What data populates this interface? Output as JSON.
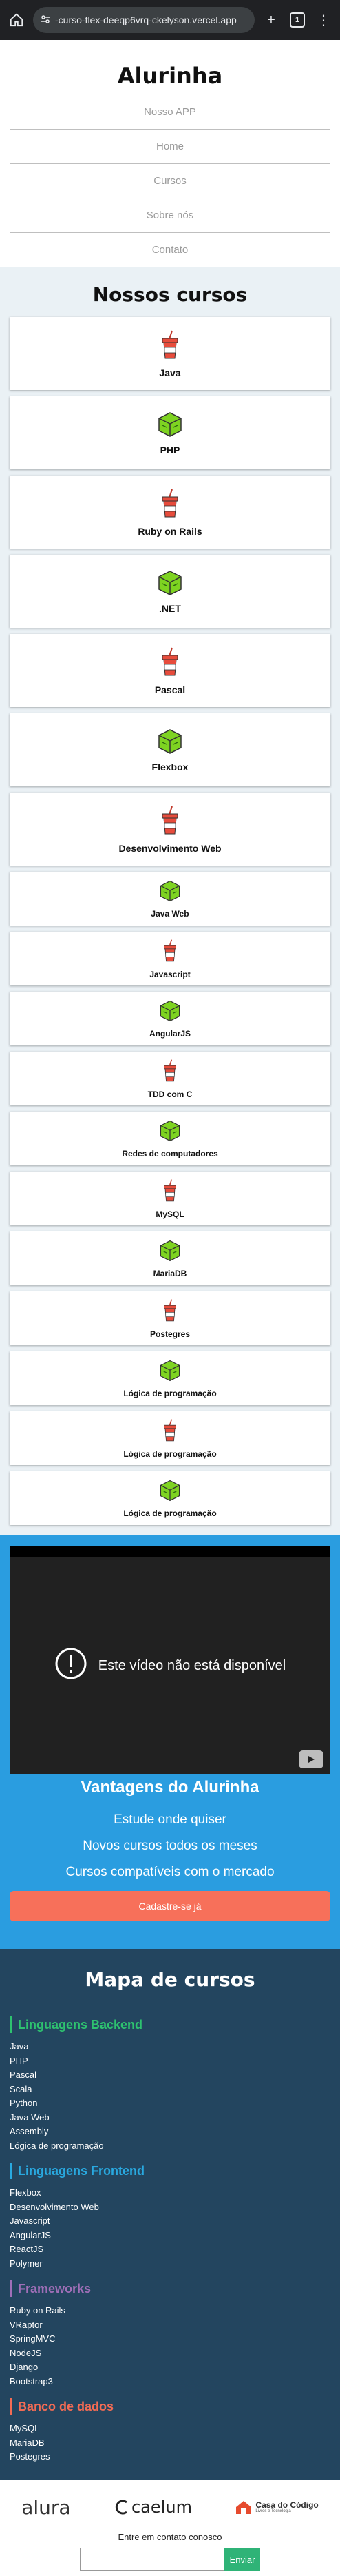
{
  "browser": {
    "url": "-curso-flex-deeqp6vrq-ckelyson.vercel.app",
    "tab_count": "1"
  },
  "header": {
    "brand": "Alurinha",
    "nav": [
      "Nosso APP",
      "Home",
      "Cursos",
      "Sobre nós",
      "Contato"
    ]
  },
  "courses": {
    "title": "Nossos cursos",
    "items": [
      {
        "name": "Java",
        "icon": "cup-icon"
      },
      {
        "name": "PHP",
        "icon": "box-icon"
      },
      {
        "name": "Ruby on Rails",
        "icon": "cup-icon"
      },
      {
        "name": ".NET",
        "icon": "box-icon"
      },
      {
        "name": "Pascal",
        "icon": "cup-icon"
      },
      {
        "name": "Flexbox",
        "icon": "box-icon"
      },
      {
        "name": "Desenvolvimento Web",
        "icon": "cup-icon"
      },
      {
        "name": "Java Web",
        "icon": "box-icon"
      },
      {
        "name": "Javascript",
        "icon": "cup-icon"
      },
      {
        "name": "AngularJS",
        "icon": "box-icon"
      },
      {
        "name": "TDD com C",
        "icon": "cup-icon"
      },
      {
        "name": "Redes de computadores",
        "icon": "box-icon"
      },
      {
        "name": "MySQL",
        "icon": "cup-icon"
      },
      {
        "name": "MariaDB",
        "icon": "box-icon"
      },
      {
        "name": "Postegres",
        "icon": "cup-icon"
      },
      {
        "name": "Lógica de programação",
        "icon": "box-icon"
      },
      {
        "name": "Lógica de programação",
        "icon": "cup-icon"
      },
      {
        "name": "Lógica de programação",
        "icon": "box-icon"
      }
    ]
  },
  "video": {
    "message": "Este vídeo não está disponível"
  },
  "advantages": {
    "title": "Vantagens do Alurinha",
    "items": [
      "Estude onde quiser",
      "Novos cursos todos os meses",
      "Cursos compatíveis com o mercado"
    ],
    "cta": "Cadastre-se já"
  },
  "map": {
    "title": "Mapa de cursos",
    "groups": [
      {
        "title": "Linguagens Backend",
        "color": "#2ec26f",
        "items": [
          "Java",
          "PHP",
          "Pascal",
          "Scala",
          "Python",
          "Java Web",
          "Assembly",
          "Lógica de programação"
        ]
      },
      {
        "title": "Linguagens Frontend",
        "color": "#29a9e0",
        "items": [
          "Flexbox",
          "Desenvolvimento Web",
          "Javascript",
          "AngularJS",
          "ReactJS",
          "Polymer"
        ]
      },
      {
        "title": "Frameworks",
        "color": "#a06fb8",
        "items": [
          "Ruby on Rails",
          "VRaptor",
          "SpringMVC",
          "NodeJS",
          "Django",
          "Bootstrap3"
        ]
      },
      {
        "title": "Banco de dados",
        "color": "#f36b54",
        "items": [
          "MySQL",
          "MariaDB",
          "Postegres"
        ]
      }
    ]
  },
  "footer": {
    "logos": [
      "alura",
      "caelum",
      "Casa do Código",
      "Livros e Tecnologia"
    ],
    "contact_label": "Entre em contato conosco",
    "send": "Enviar"
  }
}
